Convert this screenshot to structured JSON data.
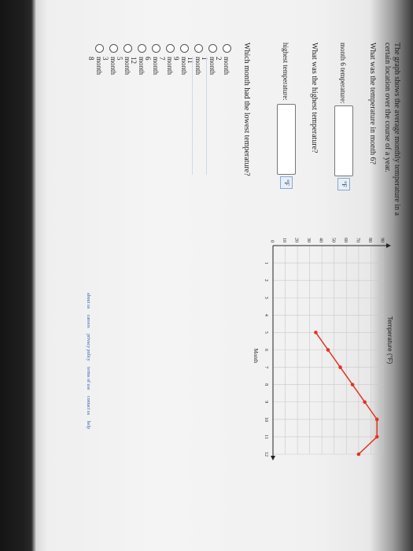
{
  "question": {
    "intro_line1": "The graph shows the average monthly temperature in a",
    "intro_line2": "certain location over the course of a year.",
    "q1": "What was the temperature in month 6?",
    "q1_label": "month 6 temperature:",
    "q1_value": "",
    "q1_unit": "°F",
    "q2": "What was the highest temperature?",
    "q2_label": "highest temperature:",
    "q2_value": "",
    "q2_unit": "°F",
    "q3": "Which month had the lowest temperature?"
  },
  "options": [
    "month 2",
    "month 1",
    "month 11",
    "month 9",
    "month 7",
    "month 6",
    "month 12",
    "month 5",
    "month 3",
    "month 8"
  ],
  "footer": [
    "about us",
    "careers",
    "privacy policy",
    "terms of use",
    "contact us",
    "help"
  ],
  "colors": {
    "line": "#e53222",
    "grid": "#c9c9c9",
    "axis": "#222222",
    "link": "#2a5db0"
  },
  "chart_data": {
    "type": "line",
    "title": "Temperature (°F)",
    "xlabel": "Month",
    "ylabel": "Temperature (°F)",
    "x": [
      1,
      2,
      3,
      4,
      5,
      6,
      7,
      8,
      9,
      10,
      11,
      12
    ],
    "values": [
      null,
      null,
      null,
      null,
      35,
      45,
      55,
      65,
      75,
      85,
      85,
      70
    ],
    "ylim": [
      0,
      90
    ],
    "xlim": [
      0,
      12
    ],
    "y_ticks": [
      0,
      10,
      20,
      30,
      40,
      50,
      60,
      70,
      80,
      90
    ],
    "x_ticks": [
      1,
      2,
      3,
      4,
      5,
      6,
      7,
      8,
      9,
      10,
      11,
      12
    ],
    "grid": true
  }
}
